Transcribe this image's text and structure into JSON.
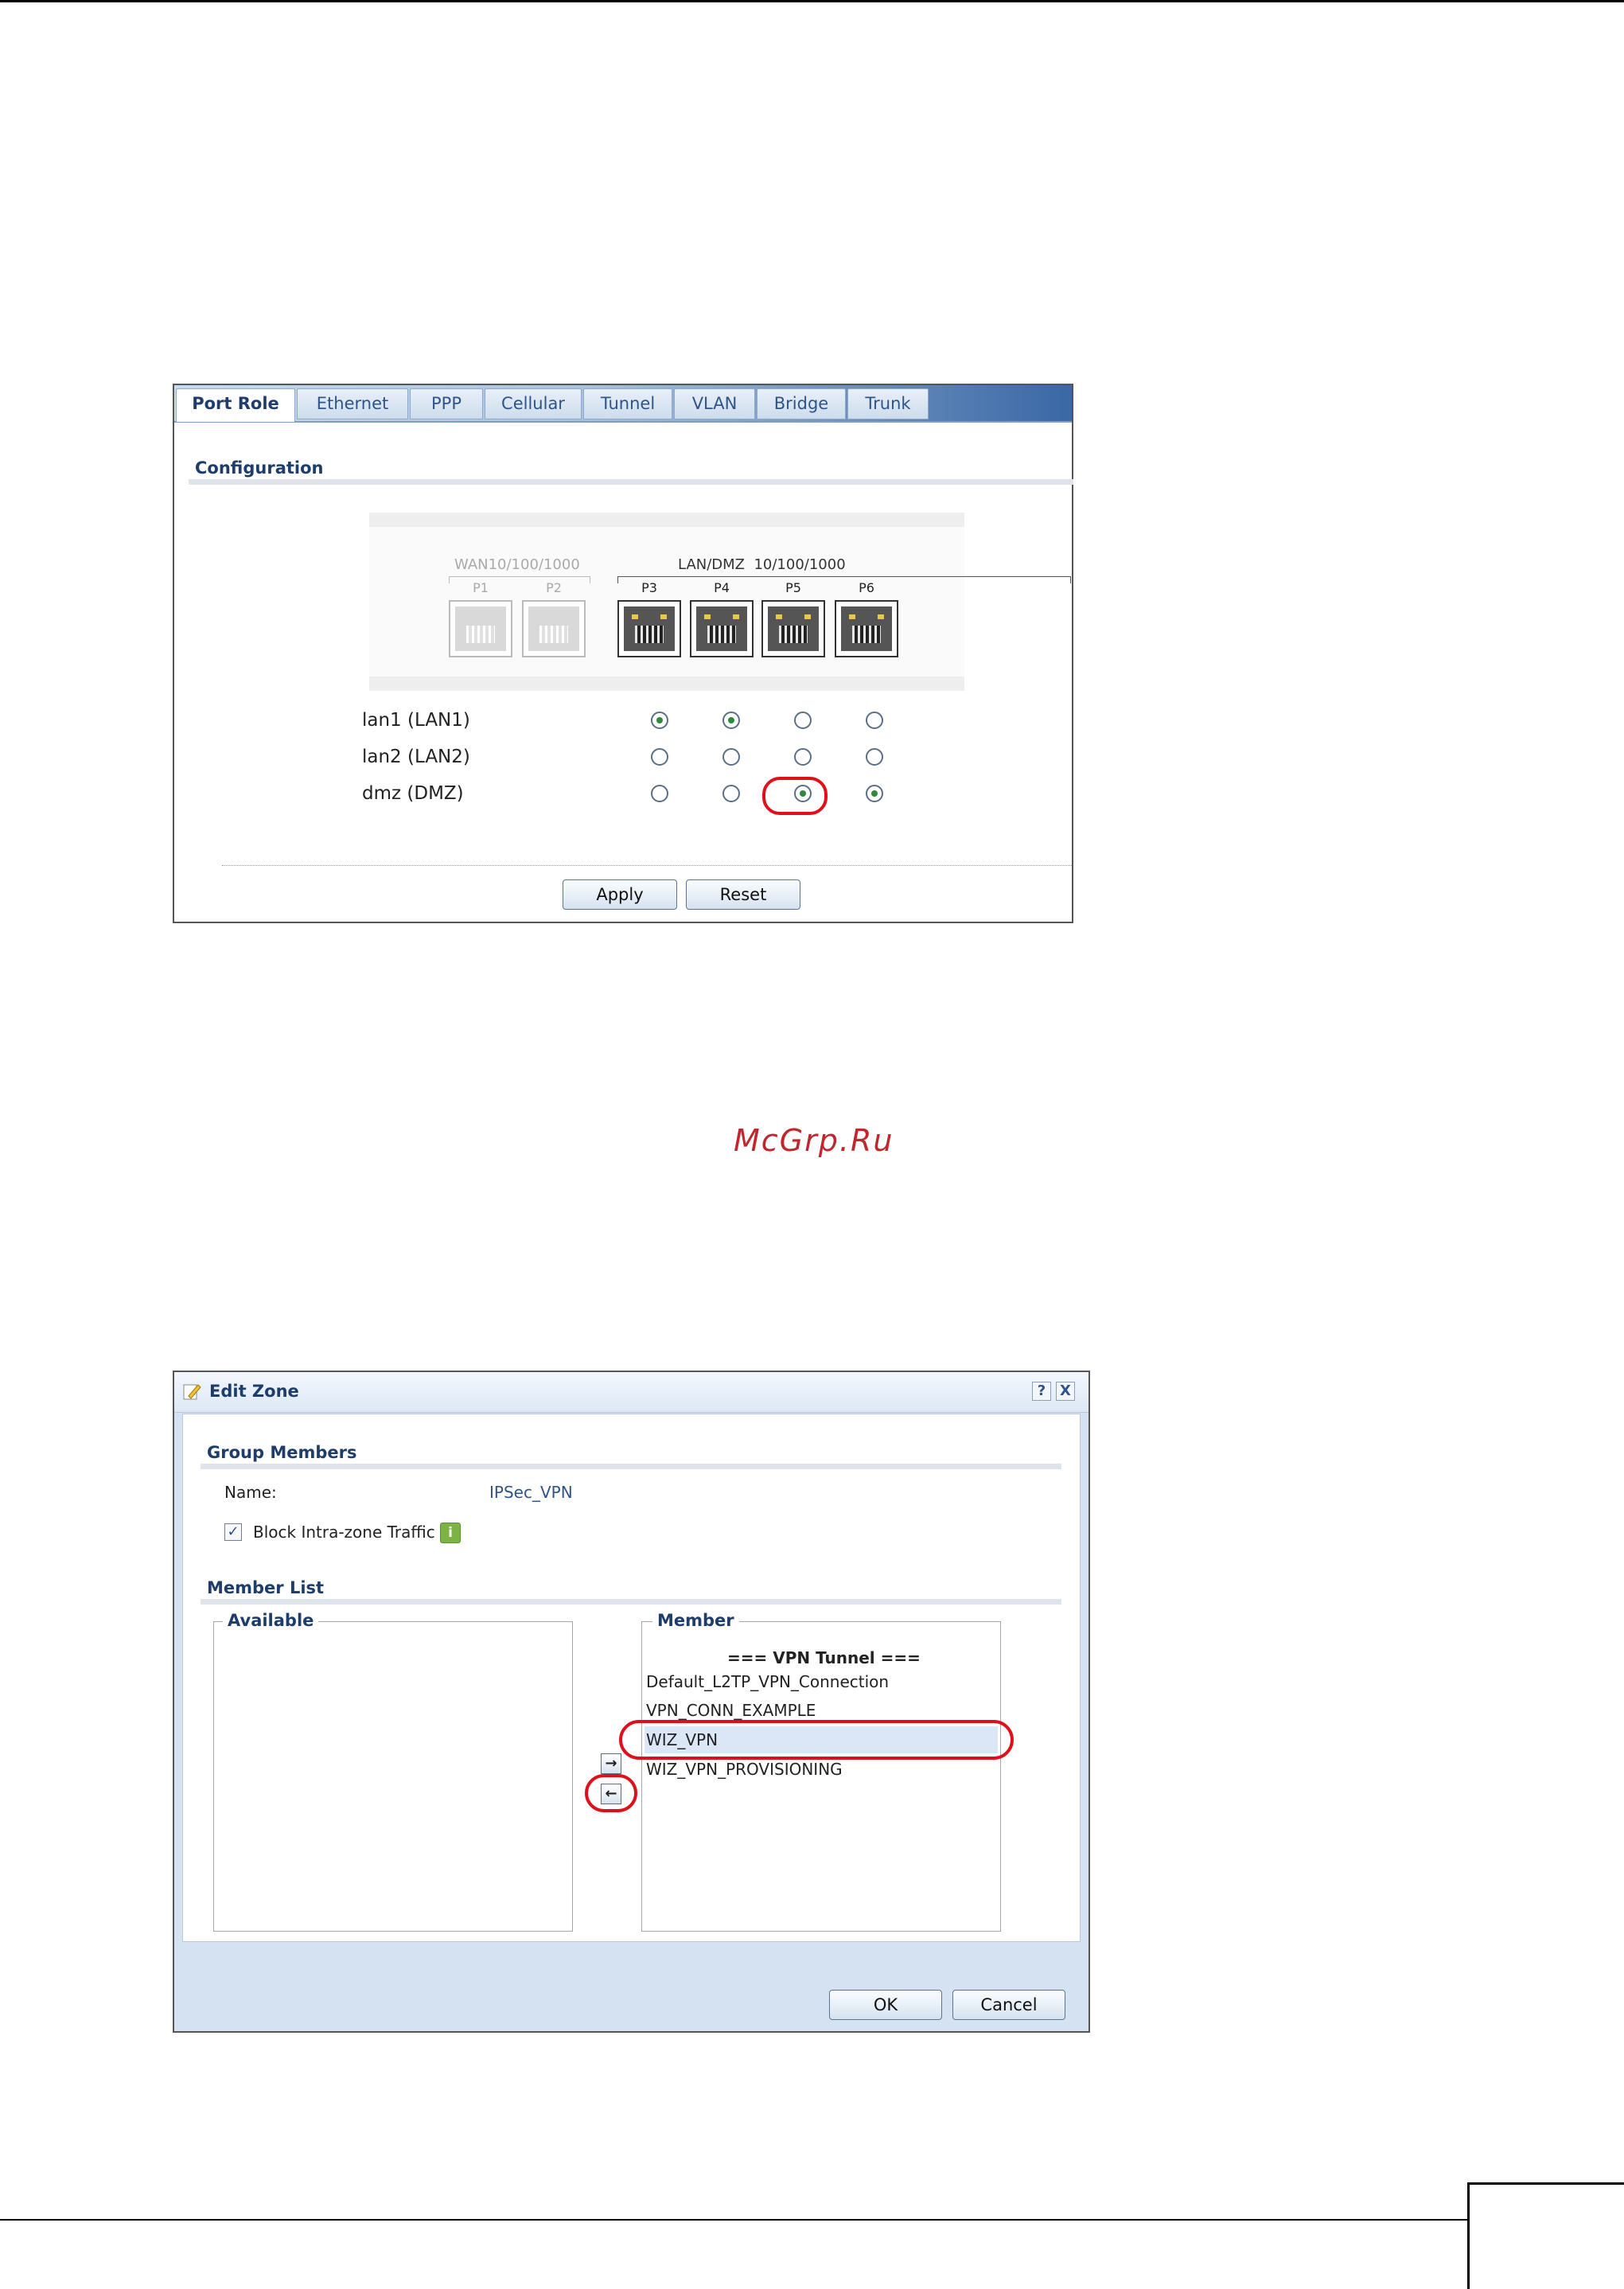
{
  "port_role_panel": {
    "tabs": [
      "Port Role",
      "Ethernet",
      "PPP",
      "Cellular",
      "Tunnel",
      "VLAN",
      "Bridge",
      "Trunk"
    ],
    "section_title": "Configuration",
    "port_groups": {
      "wan_label": "WAN10/100/1000",
      "lan_label": "LAN/DMZ  10/100/1000"
    },
    "ports": [
      "P1",
      "P2",
      "P3",
      "P4",
      "P5",
      "P6"
    ],
    "rows": [
      {
        "label": "lan1 (LAN1)",
        "selected": [
          true,
          true,
          false,
          false
        ]
      },
      {
        "label": "lan2 (LAN2)",
        "selected": [
          false,
          false,
          false,
          false
        ]
      },
      {
        "label": "dmz (DMZ)",
        "selected": [
          false,
          false,
          true,
          true
        ]
      }
    ],
    "apply_label": "Apply",
    "reset_label": "Reset"
  },
  "watermark": "McGrp.Ru",
  "edit_zone_dialog": {
    "title": "Edit Zone",
    "help_glyph": "?",
    "close_glyph": "X",
    "group_members_title": "Group Members",
    "name_label": "Name:",
    "name_value": "IPSec_VPN",
    "block_label": "Block Intra-zone Traffic",
    "block_checked": true,
    "member_list_title": "Member List",
    "available_label": "Available",
    "member_label": "Member",
    "member_group_header": "=== VPN Tunnel ===",
    "members": [
      "Default_L2TP_VPN_Connection",
      "VPN_CONN_EXAMPLE",
      "WIZ_VPN",
      "WIZ_VPN_PROVISIONING"
    ],
    "selected_member": "WIZ_VPN",
    "ok_label": "OK",
    "cancel_label": "Cancel"
  },
  "colors": {
    "accent": "#1f3d6b",
    "highlight": "#e0101a",
    "radio_on": "#2c8a3a"
  }
}
